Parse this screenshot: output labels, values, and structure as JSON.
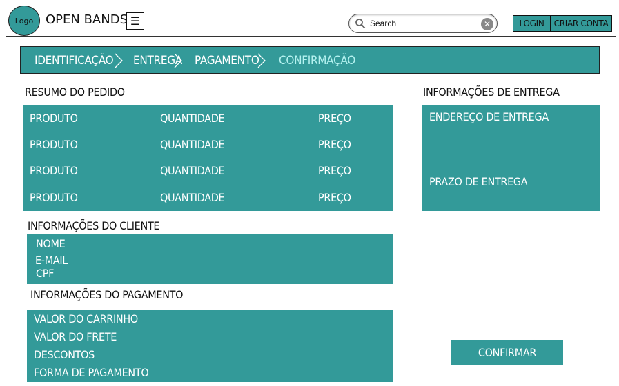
{
  "header": {
    "logo_text": "Logo",
    "brand": "OPEN BANDS",
    "menu_icon": "hamburger-icon",
    "search": {
      "placeholder": "Search",
      "value": ""
    },
    "login_label": "LOGIN",
    "signup_label": "CRIAR CONTA"
  },
  "steps": [
    {
      "label": "IDENTIFICAÇÃO"
    },
    {
      "label": "ENTREGA"
    },
    {
      "label": "PAGAMENTO"
    },
    {
      "label": "CONFIRMAÇÃO"
    }
  ],
  "order_summary": {
    "title": "RESUMO DO PEDIDO",
    "rows": [
      {
        "product": "PRODUTO",
        "quantity": "QUANTIDADE",
        "price": "PREÇO"
      },
      {
        "product": "PRODUTO",
        "quantity": "QUANTIDADE",
        "price": "PREÇO"
      },
      {
        "product": "PRODUTO",
        "quantity": "QUANTIDADE",
        "price": "PREÇO"
      },
      {
        "product": "PRODUTO",
        "quantity": "QUANTIDADE",
        "price": "PREÇO"
      }
    ]
  },
  "customer": {
    "title": "INFORMAÇÕES DO CLIENTE",
    "name": "NOME",
    "email": "E-MAIL",
    "cpf": "CPF"
  },
  "payment": {
    "title": "INFORMAÇÕES DO PAGAMENTO",
    "cart_value": "VALOR DO CARRINHO",
    "shipping_value": "VALOR DO FRETE",
    "discounts": "DESCONTOS",
    "payment_method": "FORMA DE PAGAMENTO"
  },
  "delivery": {
    "title": "INFORMAÇÕES DE ENTREGA",
    "address": "ENDEREÇO DE ENTREGA",
    "deadline": "PRAZO DE ENTREGA"
  },
  "confirm_label": "CONFIRMAR",
  "colors": {
    "accent": "#339a99",
    "active_step": "#b5f2f0"
  }
}
